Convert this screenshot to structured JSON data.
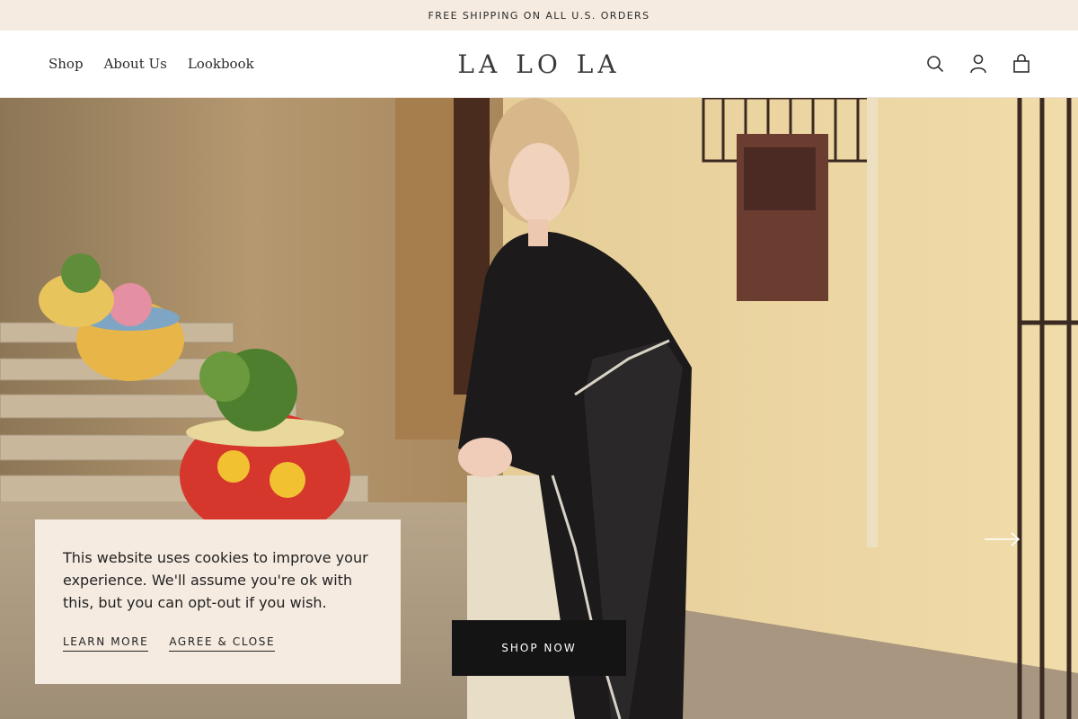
{
  "announcement": {
    "text": "FREE SHIPPING ON ALL U.S. ORDERS"
  },
  "header": {
    "nav": [
      {
        "label": "Shop"
      },
      {
        "label": "About Us"
      },
      {
        "label": "Lookbook"
      }
    ],
    "logo": {
      "parts": [
        "LA",
        "LO",
        "LA"
      ]
    },
    "icons": [
      "search-icon",
      "account-icon",
      "cart-icon"
    ]
  },
  "hero": {
    "cta_label": "SHOP NOW",
    "next_icon": "arrow-right-icon"
  },
  "cookie_banner": {
    "message": "This website uses cookies to improve your experience. We'll assume you're ok with this, but you can opt-out if you wish.",
    "learn_more": "LEARN MORE",
    "agree": "AGREE & CLOSE"
  },
  "colors": {
    "announcement_bg": "#f5ebe0",
    "cookie_bg": "#f5ebe0",
    "cta_bg": "#141414",
    "text": "#222222"
  }
}
